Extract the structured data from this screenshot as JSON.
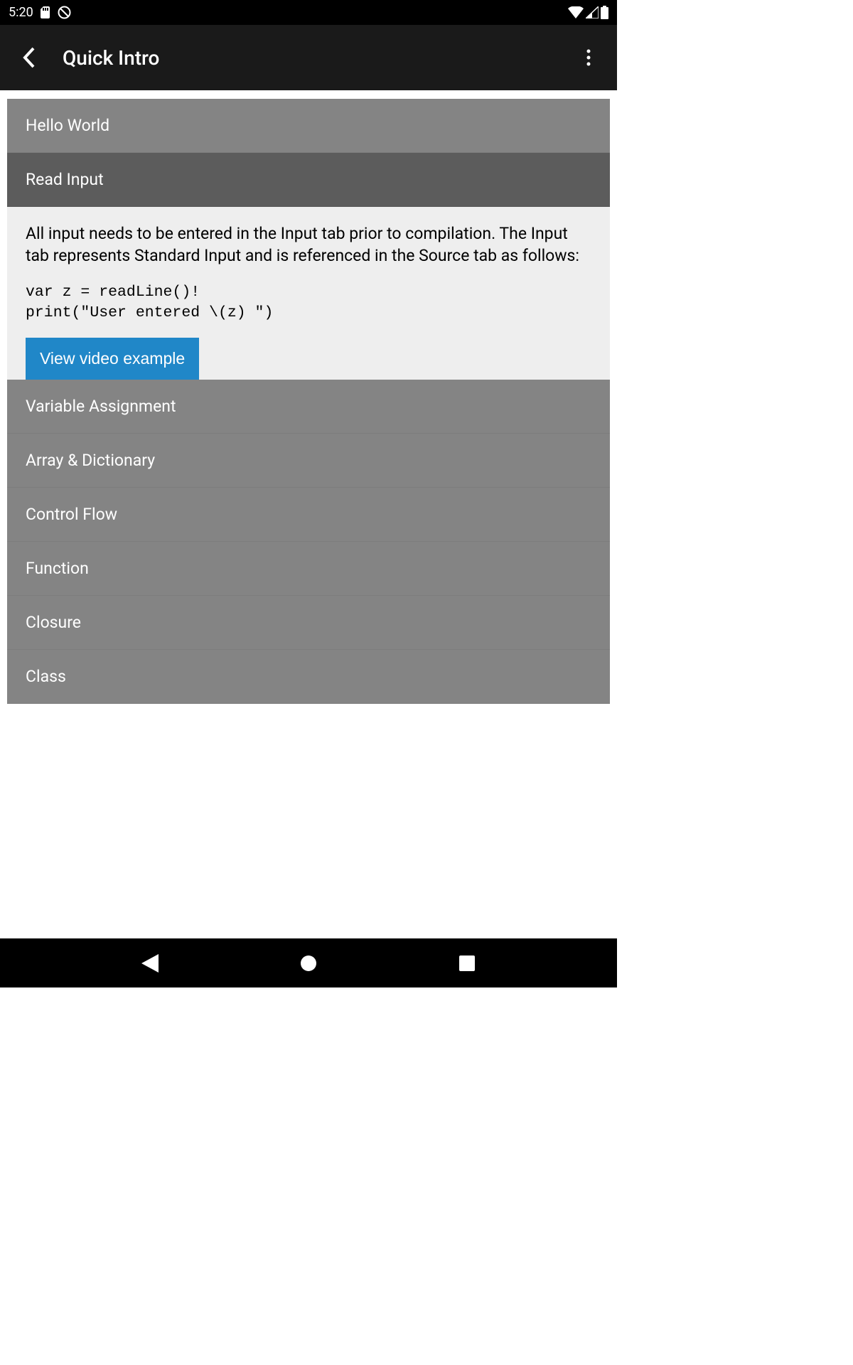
{
  "status_bar": {
    "time": "5:20"
  },
  "app_bar": {
    "title": "Quick Intro"
  },
  "list": {
    "items": [
      {
        "label": "Hello World"
      },
      {
        "label": "Read Input",
        "expanded": true
      },
      {
        "label": "Variable Assignment"
      },
      {
        "label": "Array & Dictionary"
      },
      {
        "label": "Control Flow"
      },
      {
        "label": "Function"
      },
      {
        "label": "Closure"
      },
      {
        "label": "Class"
      }
    ]
  },
  "expanded_content": {
    "description": "All input needs to be entered in the Input tab prior to compilation. The Input tab represents Standard Input and is referenced in the Source tab as follows:",
    "code": "var z = readLine()!\nprint(\"User entered \\(z) \")",
    "button_label": "View video example"
  },
  "colors": {
    "accent": "#2087c8",
    "list_bg": "#848484",
    "list_expanded_bg": "#5c5c5c",
    "content_bg": "#eeeeee"
  }
}
